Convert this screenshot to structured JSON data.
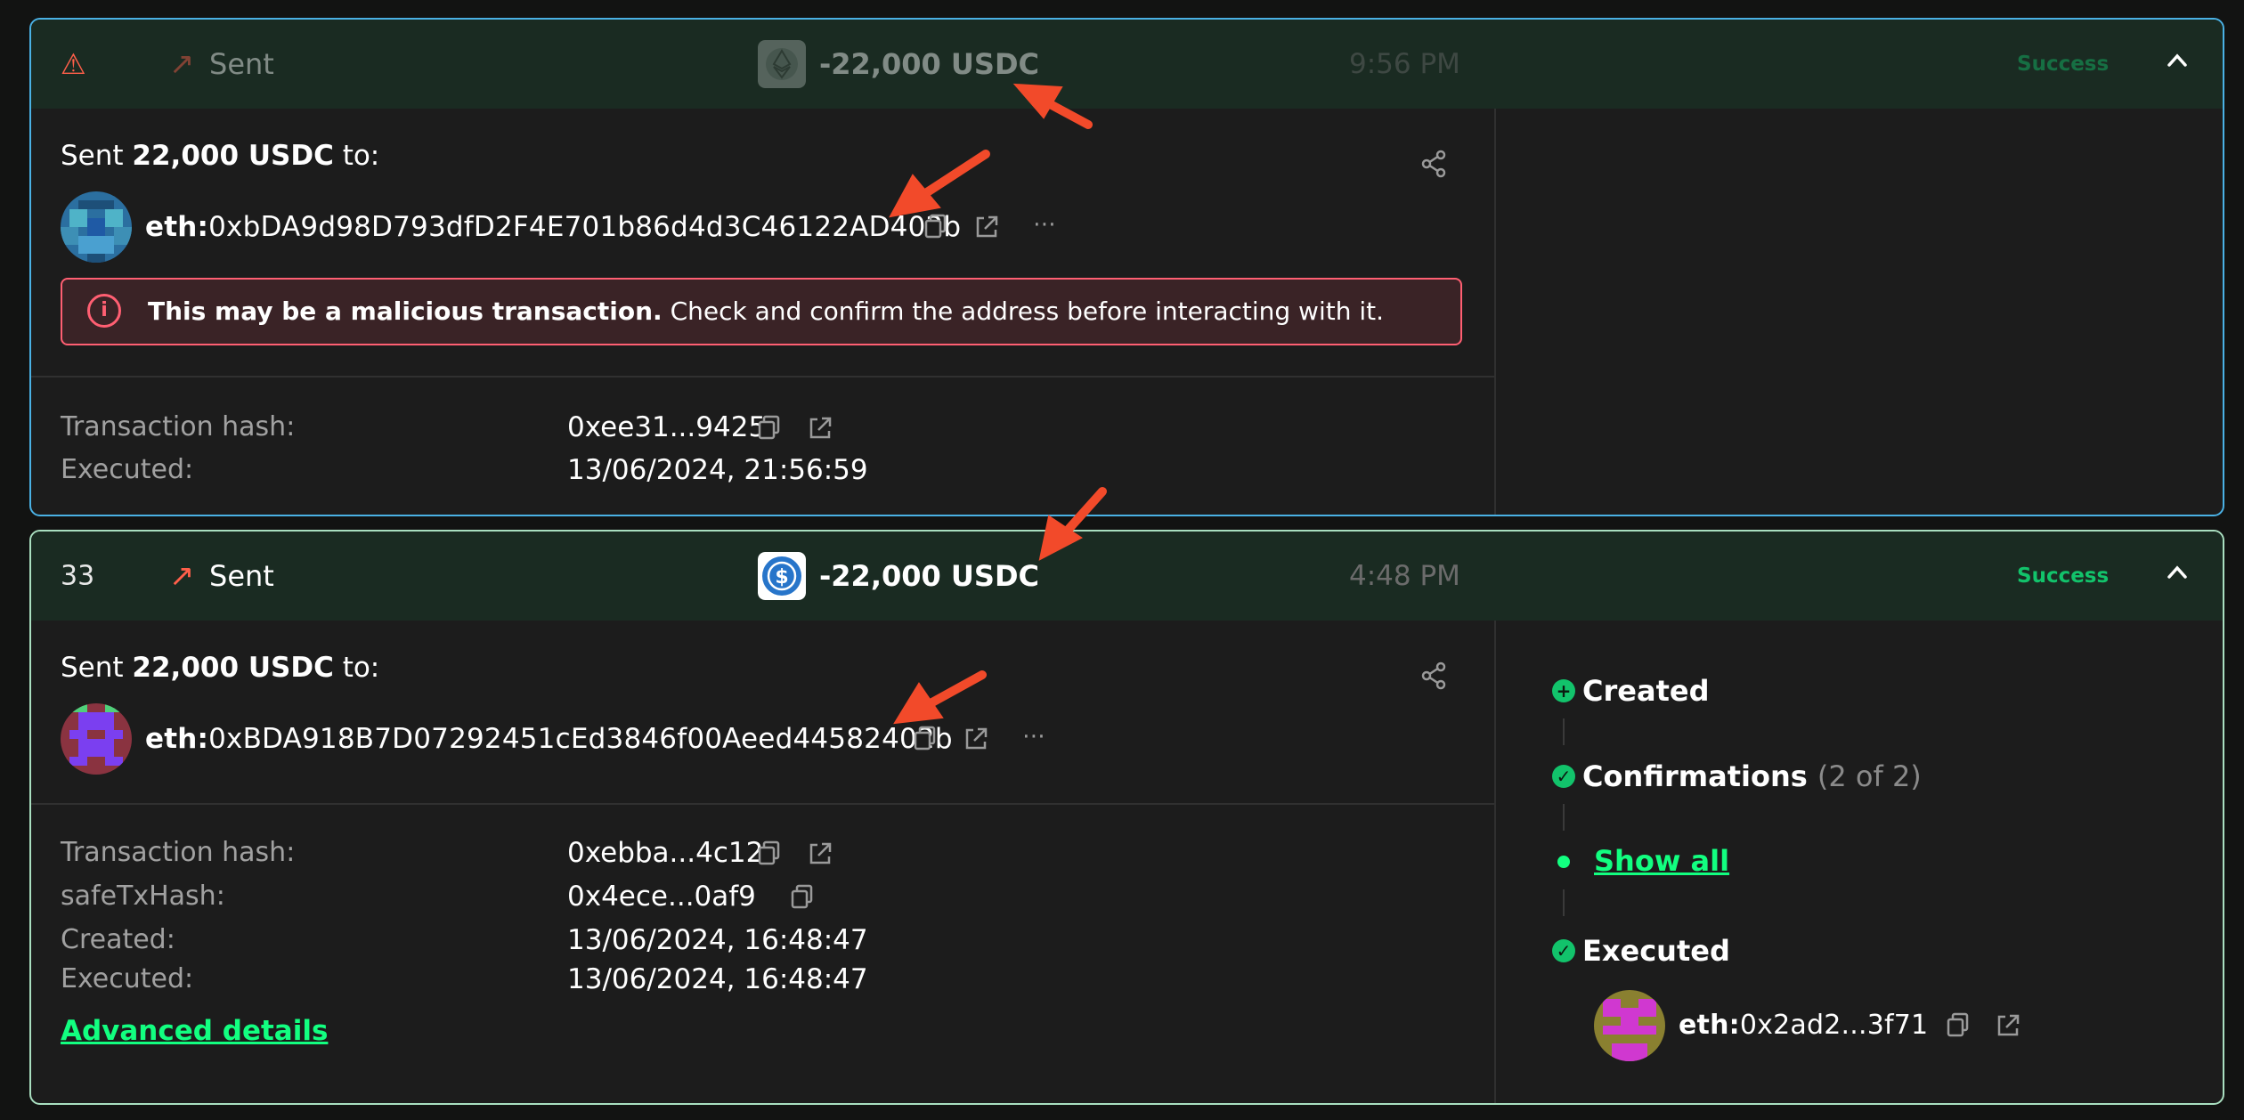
{
  "tx1": {
    "direction_label": "Sent",
    "amount": "-22,000 USDC",
    "time": "9:56 PM",
    "status": "Success",
    "sent_prefix": "Sent",
    "sent_amount": "22,000 USDC",
    "sent_suffix": "to:",
    "address_prefix": "eth:",
    "address": "0xbDA9d98D793dfD2F4E701b86d4d3C46122AD402b",
    "alert_bold": "This may be a malicious transaction.",
    "alert_text": " Check and confirm the address before interacting with it.",
    "details": [
      {
        "label": "Transaction hash:",
        "value": "0xee31...9425"
      },
      {
        "label": "Executed:",
        "value": "13/06/2024, 21:56:59"
      }
    ]
  },
  "tx2": {
    "nonce": "33",
    "direction_label": "Sent",
    "amount": "-22,000 USDC",
    "time": "4:48 PM",
    "status": "Success",
    "sent_prefix": "Sent",
    "sent_amount": "22,000 USDC",
    "sent_suffix": "to:",
    "address_prefix": "eth:",
    "address": "0xBDA918B7D07292451cEd3846f00Aeed44582402b",
    "details": [
      {
        "label": "Transaction hash:",
        "value": "0xebba...4c12"
      },
      {
        "label": "safeTxHash:",
        "value": "0x4ece...0af9"
      },
      {
        "label": "Created:",
        "value": "13/06/2024, 16:48:47"
      },
      {
        "label": "Executed:",
        "value": "13/06/2024, 16:48:47"
      }
    ],
    "advanced_details": "Advanced details",
    "timeline": {
      "created": "Created",
      "confirmations": "Confirmations",
      "confirmations_count": "(2 of 2)",
      "show_all": "Show all",
      "executed": "Executed",
      "executor_prefix": "eth:",
      "executor": "0x2ad2...3f71"
    }
  },
  "colors": {
    "accent_green": "#12ff80",
    "success_green": "#12c36b",
    "danger_red": "#ff5f72",
    "annotation_arrow": "#f24a2a"
  }
}
